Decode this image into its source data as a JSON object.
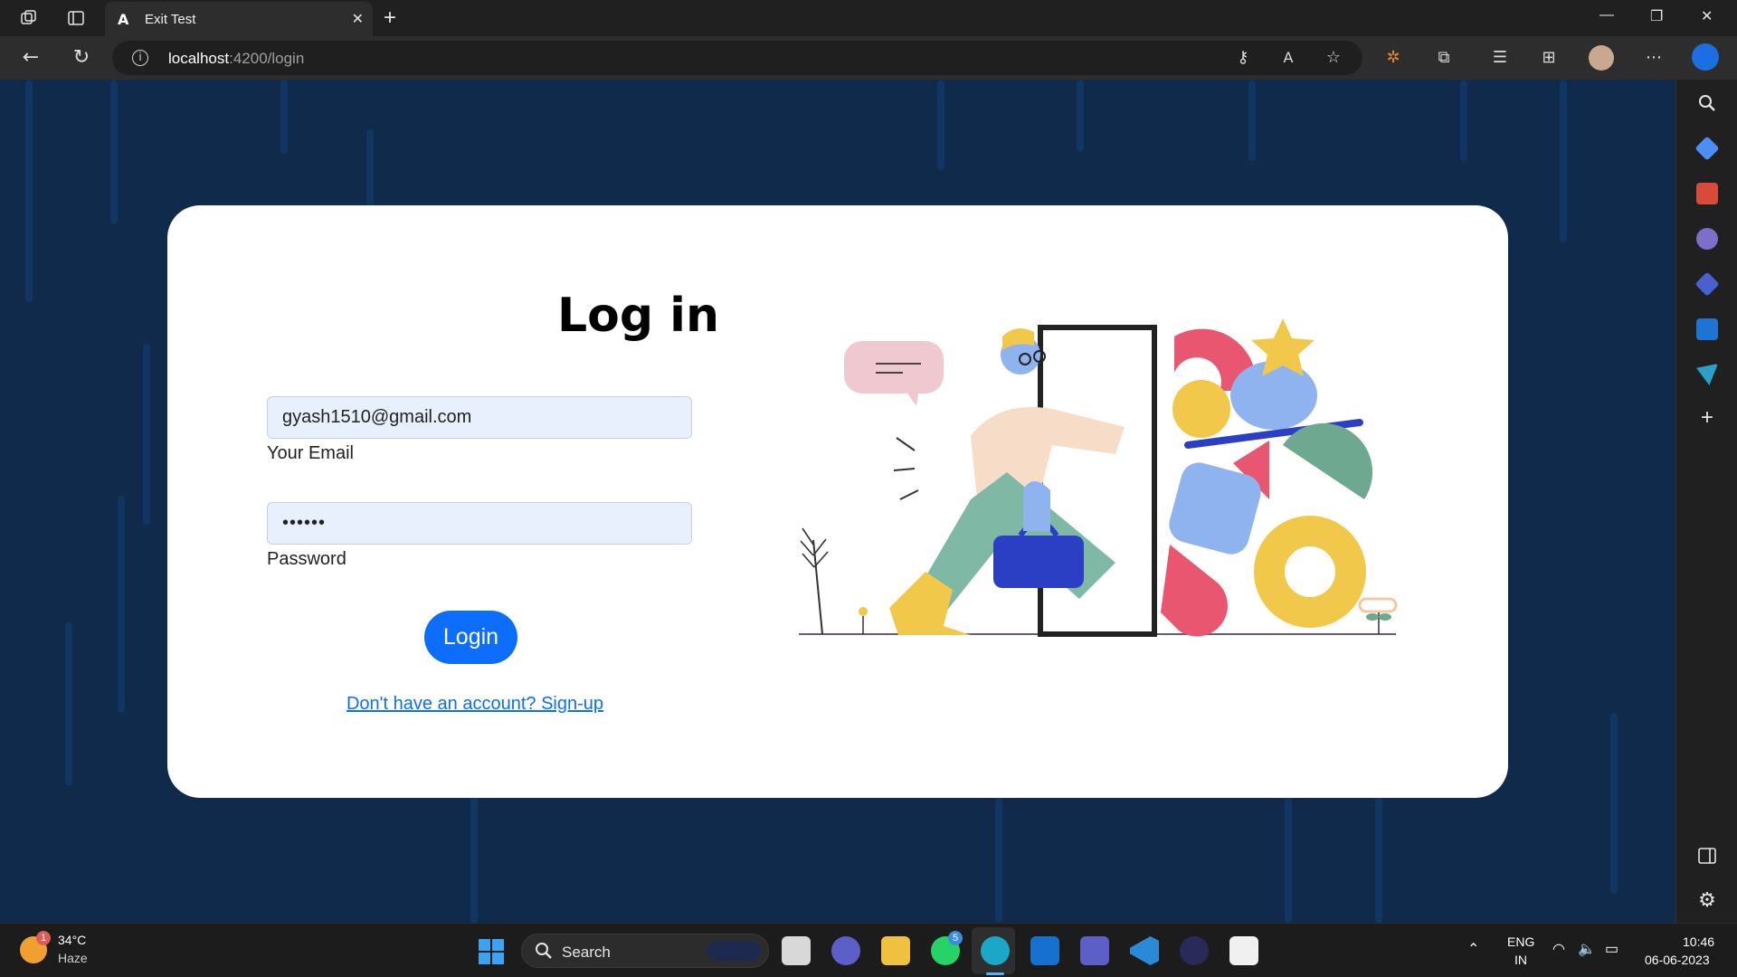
{
  "browser": {
    "tab_title": "Exit Test",
    "url_host": "localhost",
    "url_rest": ":4200/login"
  },
  "page": {
    "heading": "Log in",
    "email": {
      "value": "gyash1510@gmail.com",
      "label": "Your Email"
    },
    "password": {
      "value": "••••••",
      "label": "Password"
    },
    "login_button": "Login",
    "signup_link": "Don't have an account? Sign-up"
  },
  "taskbar": {
    "weather_temp": "34°C",
    "weather_desc": "Haze",
    "weather_badge": "1",
    "search_label": "Search",
    "whatsapp_badge": "5",
    "lang_top": "ENG",
    "lang_bottom": "IN",
    "time": "10:46",
    "date": "06-06-2023"
  },
  "colors": {
    "page_bg": "#0f2a4a",
    "accent": "#0d6efd",
    "field_bg": "#e8f0fe"
  }
}
